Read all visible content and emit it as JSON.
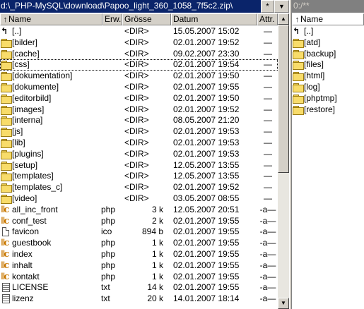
{
  "left": {
    "path": "d:\\_PHP-MySQL\\download\\Papoo_light_360_1058_7f5c2.zip\\",
    "star": "*",
    "history": "▼",
    "columns": {
      "name": "Name",
      "ext": "Erw.",
      "size": "Grösse",
      "date": "Datum",
      "attr": "Attr."
    },
    "sort_arrow": "↑",
    "rows": [
      {
        "icon": "up",
        "name": "[..]",
        "ext": "",
        "size": "<DIR>",
        "date": "15.05.2007 15:02",
        "attr": "—"
      },
      {
        "icon": "folder",
        "name": "[bilder]",
        "ext": "",
        "size": "<DIR>",
        "date": "02.01.2007 19:52",
        "attr": "—"
      },
      {
        "icon": "folder",
        "name": "[cache]",
        "ext": "",
        "size": "<DIR>",
        "date": "09.02.2007 23:30",
        "attr": "—"
      },
      {
        "icon": "folder",
        "name": "[css]",
        "ext": "",
        "size": "<DIR>",
        "date": "02.01.2007 19:54",
        "attr": "—"
      },
      {
        "icon": "folder",
        "name": "[dokumentation]",
        "ext": "",
        "size": "<DIR>",
        "date": "02.01.2007 19:50",
        "attr": "—"
      },
      {
        "icon": "folder",
        "name": "[dokumente]",
        "ext": "",
        "size": "<DIR>",
        "date": "02.01.2007 19:55",
        "attr": "—"
      },
      {
        "icon": "folder",
        "name": "[editorbild]",
        "ext": "",
        "size": "<DIR>",
        "date": "02.01.2007 19:50",
        "attr": "—"
      },
      {
        "icon": "folder",
        "name": "[images]",
        "ext": "",
        "size": "<DIR>",
        "date": "02.01.2007 19:52",
        "attr": "—"
      },
      {
        "icon": "folder",
        "name": "[interna]",
        "ext": "",
        "size": "<DIR>",
        "date": "08.05.2007 21:20",
        "attr": "—"
      },
      {
        "icon": "folder",
        "name": "[js]",
        "ext": "",
        "size": "<DIR>",
        "date": "02.01.2007 19:53",
        "attr": "—"
      },
      {
        "icon": "folder",
        "name": "[lib]",
        "ext": "",
        "size": "<DIR>",
        "date": "02.01.2007 19:53",
        "attr": "—"
      },
      {
        "icon": "folder",
        "name": "[plugins]",
        "ext": "",
        "size": "<DIR>",
        "date": "02.01.2007 19:53",
        "attr": "—"
      },
      {
        "icon": "folder",
        "name": "[setup]",
        "ext": "",
        "size": "<DIR>",
        "date": "12.05.2007 13:55",
        "attr": "—"
      },
      {
        "icon": "folder",
        "name": "[templates]",
        "ext": "",
        "size": "<DIR>",
        "date": "12.05.2007 13:55",
        "attr": "—"
      },
      {
        "icon": "folder",
        "name": "[templates_c]",
        "ext": "",
        "size": "<DIR>",
        "date": "02.01.2007 19:52",
        "attr": "—"
      },
      {
        "icon": "folder",
        "name": "[video]",
        "ext": "",
        "size": "<DIR>",
        "date": "03.05.2007 08:55",
        "attr": "—"
      },
      {
        "icon": "php",
        "name": "all_inc_front",
        "ext": "php",
        "size": "3 k",
        "date": "12.05.2007 20:51",
        "attr": "-a—"
      },
      {
        "icon": "php",
        "name": "conf_test",
        "ext": "php",
        "size": "2 k",
        "date": "02.01.2007 19:55",
        "attr": "-a—"
      },
      {
        "icon": "doc",
        "name": "favicon",
        "ext": "ico",
        "size": "894 b",
        "date": "02.01.2007 19:55",
        "attr": "-a—"
      },
      {
        "icon": "php",
        "name": "guestbook",
        "ext": "php",
        "size": "1 k",
        "date": "02.01.2007 19:55",
        "attr": "-a—"
      },
      {
        "icon": "php",
        "name": "index",
        "ext": "php",
        "size": "1 k",
        "date": "02.01.2007 19:55",
        "attr": "-a—"
      },
      {
        "icon": "php",
        "name": "inhalt",
        "ext": "php",
        "size": "1 k",
        "date": "02.01.2007 19:55",
        "attr": "-a—"
      },
      {
        "icon": "php",
        "name": "kontakt",
        "ext": "php",
        "size": "1 k",
        "date": "02.01.2007 19:55",
        "attr": "-a—"
      },
      {
        "icon": "txt",
        "name": "LICENSE",
        "ext": "txt",
        "size": "14 k",
        "date": "02.01.2007 19:55",
        "attr": "-a—"
      },
      {
        "icon": "txt",
        "name": "lizenz",
        "ext": "txt",
        "size": "20 k",
        "date": "14.01.2007 18:14",
        "attr": "-a—"
      }
    ],
    "focused_row": 3
  },
  "right": {
    "path": "0:/**",
    "columns": {
      "name": "Name"
    },
    "sort_arrow": "↑",
    "rows": [
      {
        "icon": "up",
        "name": "[..]"
      },
      {
        "icon": "folder",
        "name": "[atd]"
      },
      {
        "icon": "folder",
        "name": "[backup]"
      },
      {
        "icon": "folder",
        "name": "[files]"
      },
      {
        "icon": "folder",
        "name": "[html]"
      },
      {
        "icon": "folder",
        "name": "[log]"
      },
      {
        "icon": "folder",
        "name": "[phptmp]"
      },
      {
        "icon": "folder",
        "name": "[restore]"
      }
    ]
  },
  "colors": {
    "active_path_bg": "#0a246a",
    "inactive_path_bg": "#808080",
    "chrome": "#d4d0c8"
  }
}
